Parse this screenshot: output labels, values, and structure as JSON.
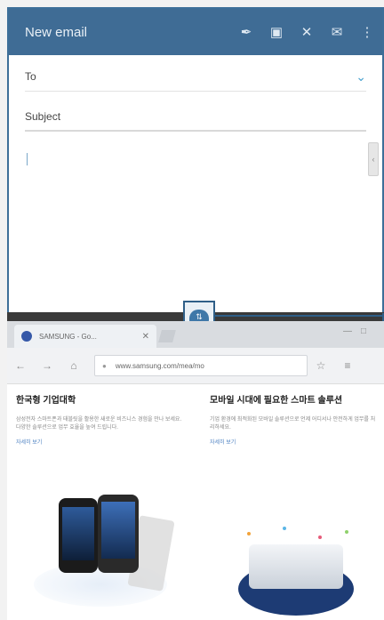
{
  "email": {
    "title": "New email",
    "icons": [
      "attach-icon",
      "camera-icon",
      "close-icon",
      "send-icon",
      "overflow-menu-icon"
    ],
    "to_label": "To",
    "subject_label": "Subject"
  },
  "browser": {
    "tab_label": "SAMSUNG - Go...",
    "url": "www.samsung.com/mea/mo",
    "left_headline": "한국형 기업대학",
    "right_headline": "모바일 시대에 필요한 스마트 솔루션",
    "left_blurb": "삼성전자 스마트폰과 태블릿을 활용한 새로운 비즈니스 경험을 만나 보세요. 다양한 솔루션으로 업무 효율을 높여 드립니다.",
    "right_blurb": "기업 환경에 최적화된 모바일 솔루션으로 언제 어디서나 안전하게 업무를 처리하세요.",
    "more_link": "자세히 보기"
  }
}
